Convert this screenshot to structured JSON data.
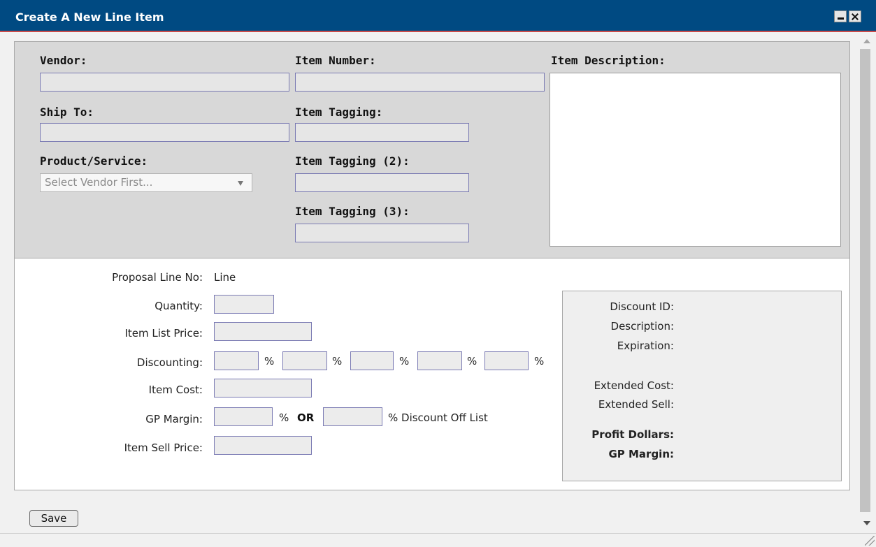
{
  "window": {
    "title": "Create A New Line Item",
    "minimize_icon": "minimize-icon",
    "close_icon": "close-icon"
  },
  "header_form": {
    "vendor_label": "Vendor:",
    "item_number_label": "Item Number:",
    "item_description_label": "Item Description:",
    "ship_to_label": "Ship To:",
    "item_tagging_label": "Item Tagging:",
    "product_service_label": "Product/Service:",
    "product_service_selected": "Select Vendor First...",
    "item_tagging_2_label": "Item Tagging (2):",
    "item_tagging_3_label": "Item Tagging (3):"
  },
  "line_form": {
    "proposal_line_label": "Proposal Line No:",
    "proposal_line_value": "Line",
    "quantity_label": "Quantity:",
    "item_list_price_label": "Item List Price:",
    "discounting_label": "Discounting:",
    "percent_symbol": "%",
    "item_cost_label": "Item Cost:",
    "gp_margin_label": "GP Margin:",
    "or_label": "OR",
    "discount_off_list_label": "% Discount Off List",
    "item_sell_price_label": "Item Sell Price:"
  },
  "discount_info": {
    "discount_id_label": "Discount ID:",
    "description_label": "Description:",
    "expiration_label": "Expiration:",
    "extended_cost_label": "Extended Cost:",
    "extended_sell_label": "Extended Sell:",
    "profit_dollars_label": "Profit Dollars:",
    "gp_margin_label": "GP Margin:"
  },
  "actions": {
    "save_label": "Save"
  }
}
